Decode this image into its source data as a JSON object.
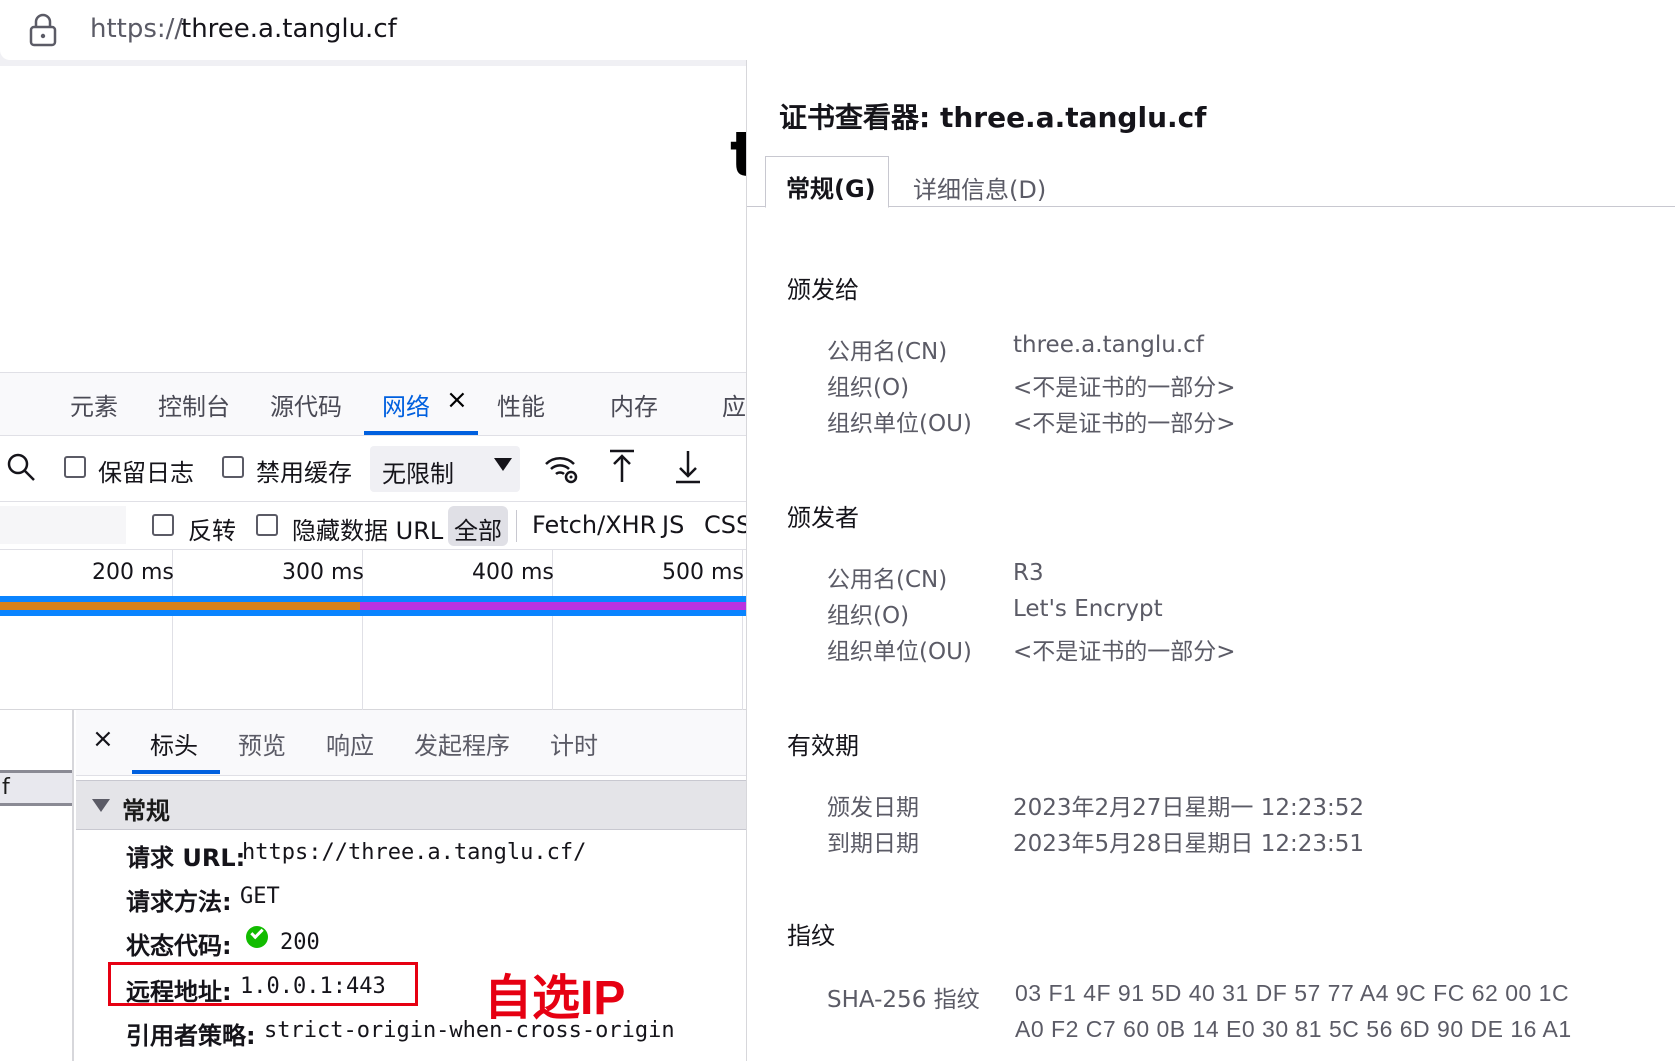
{
  "address_bar": {
    "url_scheme": "https://",
    "url_host": "three.a.tanglu.cf"
  },
  "page": {
    "visible_glyph": "t"
  },
  "devtools": {
    "tabs": [
      "元素",
      "控制台",
      "源代码",
      "网络",
      "性能",
      "内存",
      "应"
    ],
    "active_tab": "网络",
    "close_glyph": "×",
    "toolbar": {
      "preserve_log": "保留日志",
      "disable_cache": "禁用缓存",
      "throttling": "无限制"
    },
    "filters": {
      "invert": "反转",
      "hide_data_url": "隐藏数据 URL",
      "types": [
        "全部",
        "Fetch/XHR",
        "JS",
        "CSS"
      ]
    },
    "timeline": {
      "ticks": [
        "200 ms",
        "300 ms",
        "400 ms",
        "500 ms"
      ]
    },
    "request_list": {
      "row_fragment": "f"
    },
    "detail_tabs": [
      "标头",
      "预览",
      "响应",
      "发起程序",
      "计时"
    ],
    "active_detail_tab": "标头",
    "section_title": "常规",
    "headers": [
      {
        "key": "请求 URL:",
        "value": "https://three.a.tanglu.cf/"
      },
      {
        "key": "请求方法:",
        "value": "GET"
      },
      {
        "key": "状态代码:",
        "value": "200"
      },
      {
        "key": "远程地址:",
        "value": "1.0.0.1:443"
      },
      {
        "key": "引用者策略:",
        "value": "strict-origin-when-cross-origin"
      }
    ],
    "annotation": "自选IP"
  },
  "certificate_viewer": {
    "title": "证书查看器: three.a.tanglu.cf",
    "tabs": [
      "常规(G)",
      "详细信息(D)"
    ],
    "issued_to": {
      "heading": "颁发给",
      "rows": [
        {
          "key": "公用名(CN)",
          "value": "three.a.tanglu.cf"
        },
        {
          "key": "组织(O)",
          "value": "<不是证书的一部分>"
        },
        {
          "key": "组织单位(OU)",
          "value": "<不是证书的一部分>"
        }
      ]
    },
    "issued_by": {
      "heading": "颁发者",
      "rows": [
        {
          "key": "公用名(CN)",
          "value": "R3"
        },
        {
          "key": "组织(O)",
          "value": "Let's Encrypt"
        },
        {
          "key": "组织单位(OU)",
          "value": "<不是证书的一部分>"
        }
      ]
    },
    "validity": {
      "heading": "有效期",
      "rows": [
        {
          "key": "颁发日期",
          "value": "2023年2月27日星期一 12:23:52"
        },
        {
          "key": "到期日期",
          "value": "2023年5月28日星期日 12:23:51"
        }
      ]
    },
    "fingerprints": {
      "heading": "指纹",
      "sha256_label": "SHA-256 指纹",
      "sha256_line1": "03 F1 4F 91 5D 40 31 DF 57 77 A4 9C FC 62 00 1C",
      "sha256_line2": "A0 F2 C7 60 0B 14 E0 30 81 5C 56 6D 90 DE 16 A1"
    }
  },
  "colors": {
    "accent": "#0060df",
    "annotation_red": "#e60012",
    "status_ok": "#12bc00",
    "timeline_blue": "#0a84ff",
    "timeline_orange": "#d7811a",
    "timeline_purple": "#b933e1"
  }
}
